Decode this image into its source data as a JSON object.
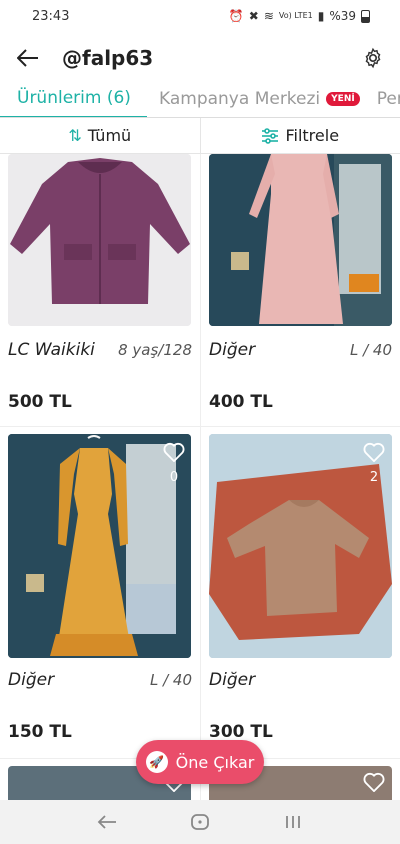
{
  "status_bar": {
    "time": "23:43",
    "network": "Vo) LTE1",
    "battery": "%39"
  },
  "header": {
    "username": "@falp63"
  },
  "tabs": [
    {
      "label": "Ürünlerim (6)"
    },
    {
      "label": "Kampanya Merkezi",
      "badge": "YENİ"
    },
    {
      "label": "Perf"
    }
  ],
  "toolbar": {
    "sort_label": "Tümü",
    "filter_label": "Filtrele"
  },
  "products": [
    {
      "brand": "LC Waikiki",
      "size": "8 yaş/128",
      "price": "500 TL"
    },
    {
      "brand": "Diğer",
      "size": "L / 40",
      "price": "400 TL"
    },
    {
      "brand": "Diğer",
      "size": "L / 40",
      "price": "150 TL",
      "likes": "0"
    },
    {
      "brand": "Diğer",
      "size": "",
      "price": "300 TL",
      "likes": "2"
    }
  ],
  "boost_button": {
    "label": "Öne Çıkar"
  },
  "colors": {
    "accent": "#1eb2a6",
    "boost": "#ea4d6a",
    "badge": "#e0193a"
  }
}
